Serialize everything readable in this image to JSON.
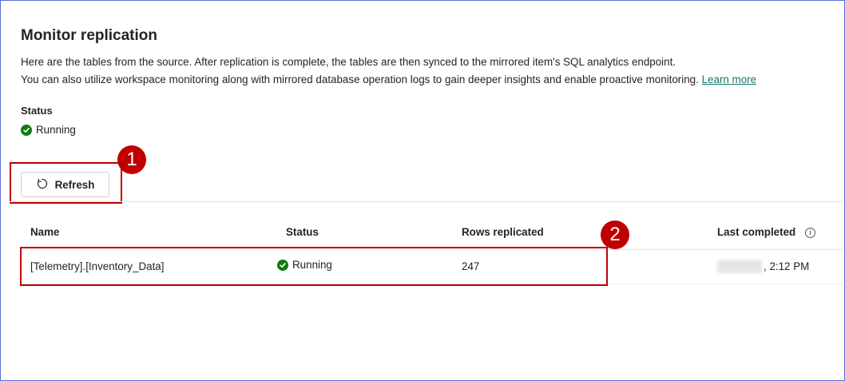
{
  "page": {
    "title": "Monitor replication",
    "description_line1": "Here are the tables from the source. After replication is complete, the tables are then synced to the mirrored item's SQL analytics endpoint.",
    "description_line2": "You can also utilize workspace monitoring along with mirrored database operation logs to gain deeper insights and enable proactive monitoring.",
    "learn_more": "Learn more"
  },
  "status": {
    "label": "Status",
    "value": "Running",
    "icon": "check-circle-icon",
    "color": "#107c10"
  },
  "toolbar": {
    "refresh_label": "Refresh",
    "refresh_icon": "refresh-icon"
  },
  "callouts": [
    "1",
    "2"
  ],
  "table": {
    "columns": [
      "Name",
      "Status",
      "Rows replicated",
      "Last completed"
    ],
    "rows": [
      {
        "name": "[Telemetry].[Inventory_Data]",
        "status": "Running",
        "rows_replicated": "247",
        "last_completed": ", 2:12 PM"
      }
    ]
  },
  "colors": {
    "accent_highlight": "#c00000",
    "link": "#117865",
    "success": "#107c10"
  }
}
